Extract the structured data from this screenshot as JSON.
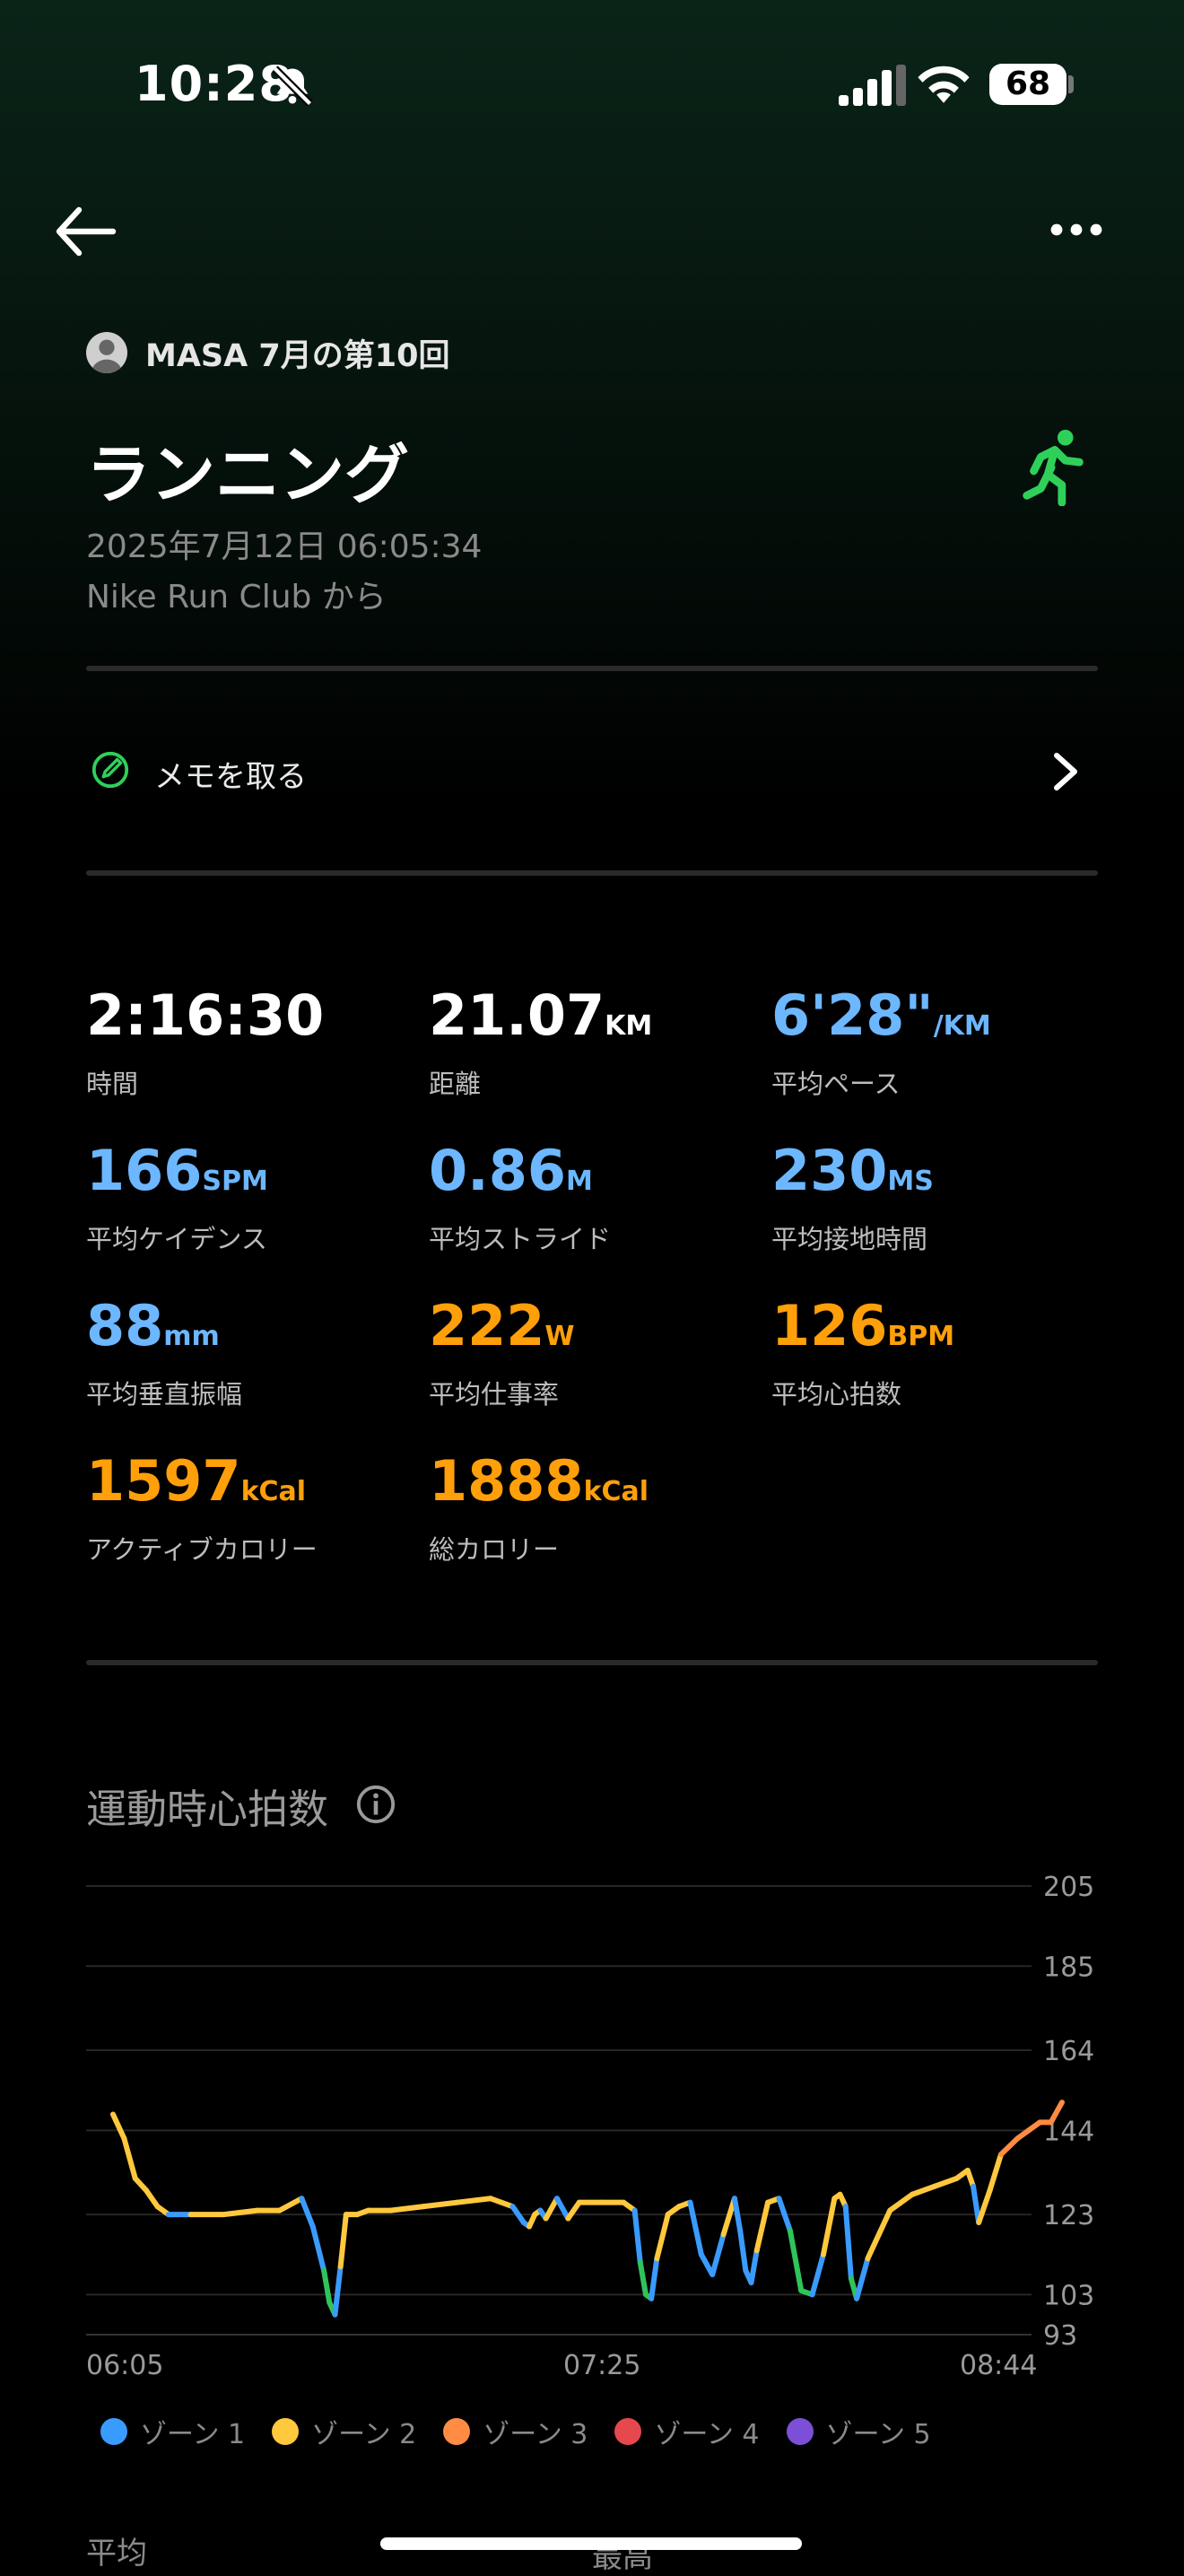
{
  "status_bar": {
    "time": "10:28",
    "battery": "68"
  },
  "header": {
    "owner": "MASA 7月の第10回",
    "title": "ランニング",
    "datetime": "2025年7月12日 06:05:34",
    "source": "Nike Run Club から"
  },
  "memo": {
    "label": "メモを取る"
  },
  "stats": [
    {
      "value": "2:16:30",
      "unit": "",
      "label": "時間",
      "color": "#ffffff"
    },
    {
      "value": "21.07",
      "unit": "KM",
      "label": "距離",
      "color": "#ffffff"
    },
    {
      "value": "6'28\"",
      "unit": "/KM",
      "label": "平均ペース",
      "color": "#6cb7ff"
    },
    {
      "value": "166",
      "unit": "SPM",
      "label": "平均ケイデンス",
      "color": "#6cb7ff"
    },
    {
      "value": "0.86",
      "unit": "M",
      "label": "平均ストライド",
      "color": "#6cb7ff"
    },
    {
      "value": "230",
      "unit": "MS",
      "label": "平均接地時間",
      "color": "#6cb7ff"
    },
    {
      "value": "88",
      "unit": "mm",
      "label": "平均垂直振幅",
      "color": "#6cb7ff"
    },
    {
      "value": "222",
      "unit": "W",
      "label": "平均仕事率",
      "color": "#ff9f0a"
    },
    {
      "value": "126",
      "unit": "BPM",
      "label": "平均心拍数",
      "color": "#ff9f0a"
    },
    {
      "value": "1597",
      "unit": "kCal",
      "label": "アクティブカロリー",
      "color": "#ff9f0a"
    },
    {
      "value": "1888",
      "unit": "kCal",
      "label": "総カロリー",
      "color": "#ff9f0a"
    }
  ],
  "chart": {
    "title": "運動時心拍数"
  },
  "chart_data": {
    "type": "line",
    "title": "運動時心拍数",
    "x_ticks": [
      "06:05",
      "07:25",
      "08:44"
    ],
    "y_ticks": [
      205,
      185,
      164,
      144,
      123,
      103,
      93
    ],
    "ylim": [
      93,
      205
    ],
    "x": [
      0,
      2,
      4,
      6,
      8,
      10,
      14,
      20,
      26,
      30,
      34,
      36,
      38,
      39,
      40,
      41,
      42,
      44,
      46,
      50,
      56,
      62,
      68,
      72,
      74,
      75,
      76,
      77,
      78,
      80,
      82,
      84,
      88,
      92,
      94,
      95,
      96,
      97,
      98,
      100,
      102,
      104,
      106,
      108,
      110,
      112,
      113,
      114,
      115,
      116,
      118,
      120,
      122,
      124,
      126,
      128,
      130,
      131,
      132,
      133,
      134,
      136,
      140,
      144,
      148,
      152,
      154,
      155,
      156,
      158,
      160,
      163,
      165,
      167,
      169,
      171
    ],
    "series": [
      {
        "values": [
          148,
          142,
          132,
          129,
          125,
          123,
          123,
          123,
          124,
          124,
          127,
          120,
          109,
          101,
          98,
          110,
          123,
          123,
          124,
          124,
          125,
          126,
          127,
          125,
          121,
          120,
          123,
          124,
          122,
          127,
          122,
          126,
          126,
          126,
          124,
          111,
          103,
          102,
          112,
          123,
          125,
          126,
          113,
          108,
          118,
          127,
          119,
          109,
          106,
          114,
          126,
          127,
          119,
          104,
          103,
          113,
          127,
          128,
          125,
          107,
          102,
          112,
          124,
          128,
          130,
          132,
          134,
          130,
          121,
          129,
          138,
          142,
          144,
          146,
          146,
          151
        ],
        "zone_colors": [
          "#ff8c42",
          "#ffc83d",
          "#ffc83d",
          "#ffc83d",
          "#ffc83d",
          "#ffc83d",
          "#3a9bff",
          "#ffc83d",
          "#ffc83d",
          "#ffc83d",
          "#ffc83d",
          "#3a9bff",
          "#3a9bff",
          "#2fc45a",
          "#2fc45a",
          "#3a9bff",
          "#ffc83d",
          "#ffc83d",
          "#ffc83d",
          "#ffc83d",
          "#ffc83d",
          "#ffc83d",
          "#ffc83d",
          "#ffc83d",
          "#3a9bff",
          "#3a9bff",
          "#ffc83d",
          "#ffc83d",
          "#3a9bff",
          "#ffc83d",
          "#3a9bff",
          "#ffc83d",
          "#ffc83d",
          "#ffc83d",
          "#ffc83d",
          "#3a9bff",
          "#2fc45a",
          "#2fc45a",
          "#3a9bff",
          "#ffc83d",
          "#ffc83d",
          "#ffc83d",
          "#3a9bff",
          "#3a9bff",
          "#3a9bff",
          "#ffc83d",
          "#3a9bff",
          "#3a9bff",
          "#3a9bff",
          "#3a9bff",
          "#ffc83d",
          "#ffc83d",
          "#3a9bff",
          "#2fc45a",
          "#2fc45a",
          "#3a9bff",
          "#ffc83d",
          "#ffc83d",
          "#ffc83d",
          "#3a9bff",
          "#2fc45a",
          "#3a9bff",
          "#ffc83d",
          "#ffc83d",
          "#ffc83d",
          "#ffc83d",
          "#ffc83d",
          "#ffc83d",
          "#3a9bff",
          "#ffc83d",
          "#ffc83d",
          "#ff8c42",
          "#ff8c42",
          "#ff8c42",
          "#ff8c42",
          "#ff8c42"
        ]
      }
    ],
    "legend": [
      {
        "label": "ゾーン 1",
        "color": "#3a9bff"
      },
      {
        "label": "ゾーン 2",
        "color": "#ffc83d"
      },
      {
        "label": "ゾーン 3",
        "color": "#ff8c42"
      },
      {
        "label": "ゾーン 4",
        "color": "#e5484d"
      },
      {
        "label": "ゾーン 5",
        "color": "#7b4fd6"
      }
    ],
    "grid": true
  },
  "footer": {
    "avg_label": "平均",
    "max_label": "最高"
  }
}
